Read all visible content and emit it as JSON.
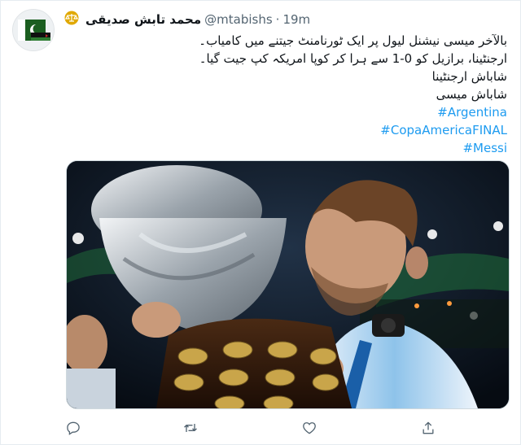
{
  "tweet": {
    "display_name": "محمد تابش صدیقی",
    "handle": "@mtabishs",
    "separator": "·",
    "time": "19m",
    "body_lines": [
      "بالآخر میسی نیشنل لیول پر ایک ٹورنامنٹ جیتنے میں کامیاب۔",
      "ارجنٹینا، برازیل کو 0-1 سے ہرا کر کوپا امریکہ کپ جیت گیا۔",
      "شاباش ارجنٹینا",
      "شاباش میسی"
    ],
    "hashtags": [
      "#Argentina",
      "#CopaAmericaFINAL",
      "#Messi"
    ]
  },
  "icons": {
    "badge": "scales-icon",
    "reply": "reply-icon",
    "retweet": "retweet-icon",
    "like": "heart-icon",
    "share": "share-icon"
  },
  "colors": {
    "link": "#1d9bf0",
    "secondary": "#536471",
    "badge": "#e0a800"
  }
}
